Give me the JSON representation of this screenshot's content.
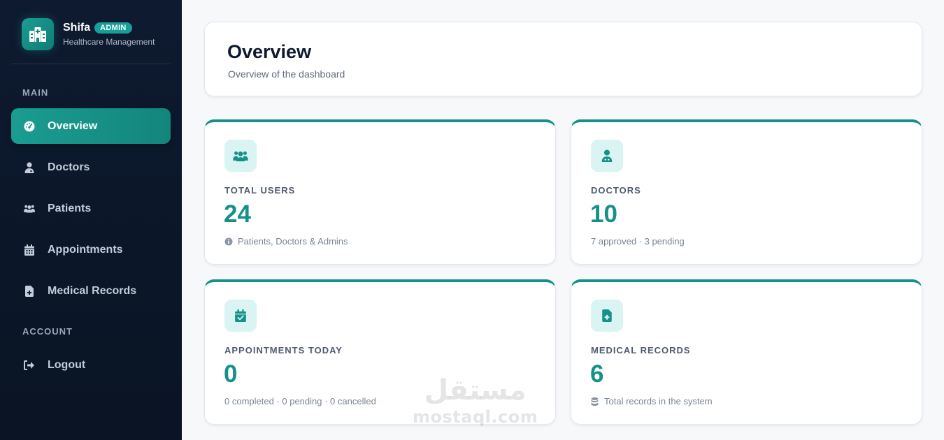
{
  "brand": {
    "name": "Shifa",
    "badge": "ADMIN",
    "subtitle": "Healthcare Management",
    "logo_icon": "hospital-icon"
  },
  "sidebar": {
    "sections": [
      {
        "label": "MAIN"
      },
      {
        "label": "ACCOUNT"
      }
    ],
    "items": [
      {
        "label": "Overview",
        "icon": "gauge-icon",
        "active": true
      },
      {
        "label": "Doctors",
        "icon": "user-doctor-icon"
      },
      {
        "label": "Patients",
        "icon": "users-icon"
      },
      {
        "label": "Appointments",
        "icon": "calendar-icon"
      },
      {
        "label": "Medical Records",
        "icon": "file-medical-icon"
      },
      {
        "label": "Logout",
        "icon": "logout-icon"
      }
    ]
  },
  "header": {
    "title": "Overview",
    "subtitle": "Overview of the dashboard"
  },
  "stats": [
    {
      "label": "TOTAL USERS",
      "value": "24",
      "note": "Patients, Doctors & Admins",
      "icon": "users-icon",
      "note_icon": "info-icon"
    },
    {
      "label": "DOCTORS",
      "value": "10",
      "note": "7 approved · 3 pending",
      "icon": "user-doctor-icon"
    },
    {
      "label": "APPOINTMENTS TODAY",
      "value": "0",
      "note": "0 completed · 0 pending · 0 cancelled",
      "icon": "calendar-check-icon"
    },
    {
      "label": "MEDICAL RECORDS",
      "value": "6",
      "note": "Total records in the system",
      "icon": "file-medical-icon",
      "note_icon": "database-icon"
    }
  ],
  "watermark": {
    "arabic": "مستقل",
    "latin": "mostaql.com"
  },
  "colors": {
    "accent": "#15908a",
    "sidebar_bg": "#0b1628",
    "icon_bg": "#d9f4f2"
  }
}
